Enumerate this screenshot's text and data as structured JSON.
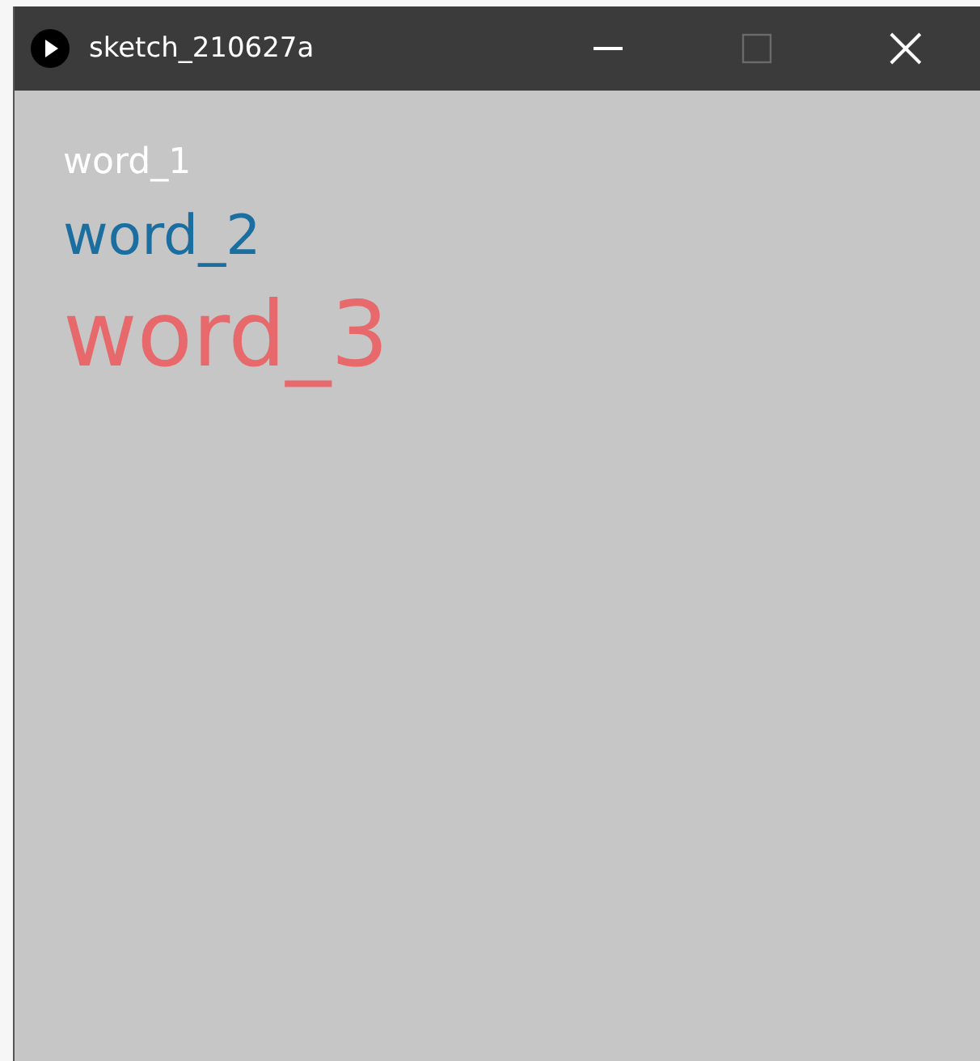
{
  "window": {
    "title": "sketch_210627a",
    "maximize_disabled": true
  },
  "words": [
    {
      "text": "word_1",
      "color": "#ffffff"
    },
    {
      "text": "word_2",
      "color": "#1b6fa0"
    },
    {
      "text": "word_3",
      "color": "#e8696b"
    }
  ]
}
